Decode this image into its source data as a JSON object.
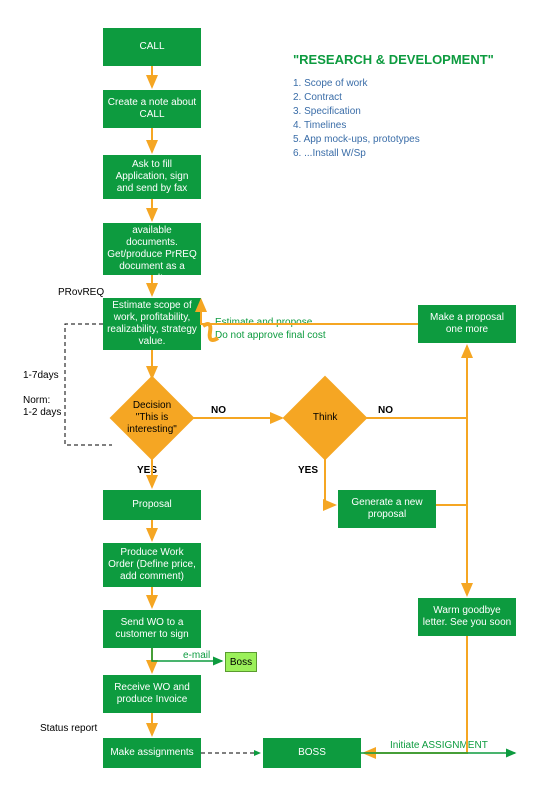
{
  "boxes": {
    "call": "CALL",
    "note": "Create a note about CALL",
    "ask": "Ask to fill Application, sign and send by fax",
    "request": "Request all available documents. Get/produce PrREQ document as a result.",
    "estimate": "Estimate scope of work, profitability, realizability, strategy value.",
    "proposal": "Proposal",
    "wo": "Produce Work Order (Define price, add comment)",
    "send": "Send WO to a customer to sign",
    "receive": "Receive WO and produce Invoice",
    "assign": "Make assignments",
    "boss2": "BOSS",
    "more": "Make a proposal one more",
    "gen": "Generate a new proposal",
    "warm": "Warm goodbye letter. See you soon"
  },
  "diamonds": {
    "d1": "Decision \"This is interesting\"",
    "d2": "Think"
  },
  "labels": {
    "provreq": "PRovREQ",
    "time1": "1-7days",
    "time2a": "Norm:",
    "time2b": "1-2 days",
    "no1": "NO",
    "no2": "NO",
    "yes1": "YES",
    "yes2": "YES",
    "email": "e-mail",
    "status": "Status report",
    "boss": "Boss",
    "initiate": "Initiate ASSIGNMENT"
  },
  "ann": {
    "est1": "Estimate and propose.",
    "est2": "Do not approve final cost"
  },
  "title": "\"RESEARCH & DEVELOPMENT\"",
  "list": {
    "i1": "1. Scope of work",
    "i2": "2. Contract",
    "i3": "3. Specification",
    "i4": "4. Timelines",
    "i5": "5. App mock-ups, prototypes",
    "i6": "6. ...Install W/Sp"
  },
  "chart_data": {
    "type": "flowchart",
    "title": "RESEARCH & DEVELOPMENT",
    "nodes": [
      {
        "id": "call",
        "type": "process",
        "label": "CALL"
      },
      {
        "id": "note",
        "type": "process",
        "label": "Create a note about CALL"
      },
      {
        "id": "ask",
        "type": "process",
        "label": "Ask to fill Application, sign and send by fax"
      },
      {
        "id": "request",
        "type": "process",
        "label": "Request all available documents. Get/produce PrREQ document as a result."
      },
      {
        "id": "estimate",
        "type": "process",
        "label": "Estimate scope of work, profitability, realizability, strategy value."
      },
      {
        "id": "d1",
        "type": "decision",
        "label": "Decision \"This is interesting\""
      },
      {
        "id": "d2",
        "type": "decision",
        "label": "Think"
      },
      {
        "id": "proposal",
        "type": "process",
        "label": "Proposal"
      },
      {
        "id": "wo",
        "type": "process",
        "label": "Produce Work Order (Define price, add comment)"
      },
      {
        "id": "send",
        "type": "process",
        "label": "Send WO to a customer to sign"
      },
      {
        "id": "receive",
        "type": "process",
        "label": "Receive WO and produce Invoice"
      },
      {
        "id": "assign",
        "type": "process",
        "label": "Make assignments"
      },
      {
        "id": "boss2",
        "type": "process",
        "label": "BOSS"
      },
      {
        "id": "more",
        "type": "process",
        "label": "Make a proposal one more"
      },
      {
        "id": "gen",
        "type": "process",
        "label": "Generate a new proposal"
      },
      {
        "id": "warm",
        "type": "process",
        "label": "Warm goodbye letter. See you soon"
      },
      {
        "id": "bossSmall",
        "type": "process",
        "label": "Boss"
      }
    ],
    "edges": [
      {
        "from": "call",
        "to": "note"
      },
      {
        "from": "note",
        "to": "ask"
      },
      {
        "from": "ask",
        "to": "request"
      },
      {
        "from": "request",
        "to": "estimate",
        "label": "PRovREQ"
      },
      {
        "from": "estimate",
        "to": "d1"
      },
      {
        "from": "d1",
        "to": "proposal",
        "label": "YES"
      },
      {
        "from": "d1",
        "to": "d2",
        "label": "NO"
      },
      {
        "from": "d2",
        "to": "gen",
        "label": "YES"
      },
      {
        "from": "d2",
        "to": "warm",
        "label": "NO"
      },
      {
        "from": "gen",
        "to": "more"
      },
      {
        "from": "more",
        "to": "estimate"
      },
      {
        "from": "proposal",
        "to": "wo"
      },
      {
        "from": "wo",
        "to": "send"
      },
      {
        "from": "send",
        "to": "bossSmall",
        "label": "e-mail"
      },
      {
        "from": "send",
        "to": "receive"
      },
      {
        "from": "receive",
        "to": "assign"
      },
      {
        "from": "assign",
        "to": "boss2",
        "label": "Status report"
      },
      {
        "from": "boss2",
        "to": null,
        "label": "Initiate ASSIGNMENT"
      },
      {
        "from": "d1",
        "to": "estimate",
        "label": "1-7days Norm: 1-2 days",
        "style": "dashed"
      }
    ],
    "legend": [
      "1. Scope of work",
      "2. Contract",
      "3. Specification",
      "4. Timelines",
      "5. App mock-ups, prototypes",
      "6. ...Install W/Sp"
    ],
    "annotation": "Estimate and propose. Do not approve final cost"
  }
}
